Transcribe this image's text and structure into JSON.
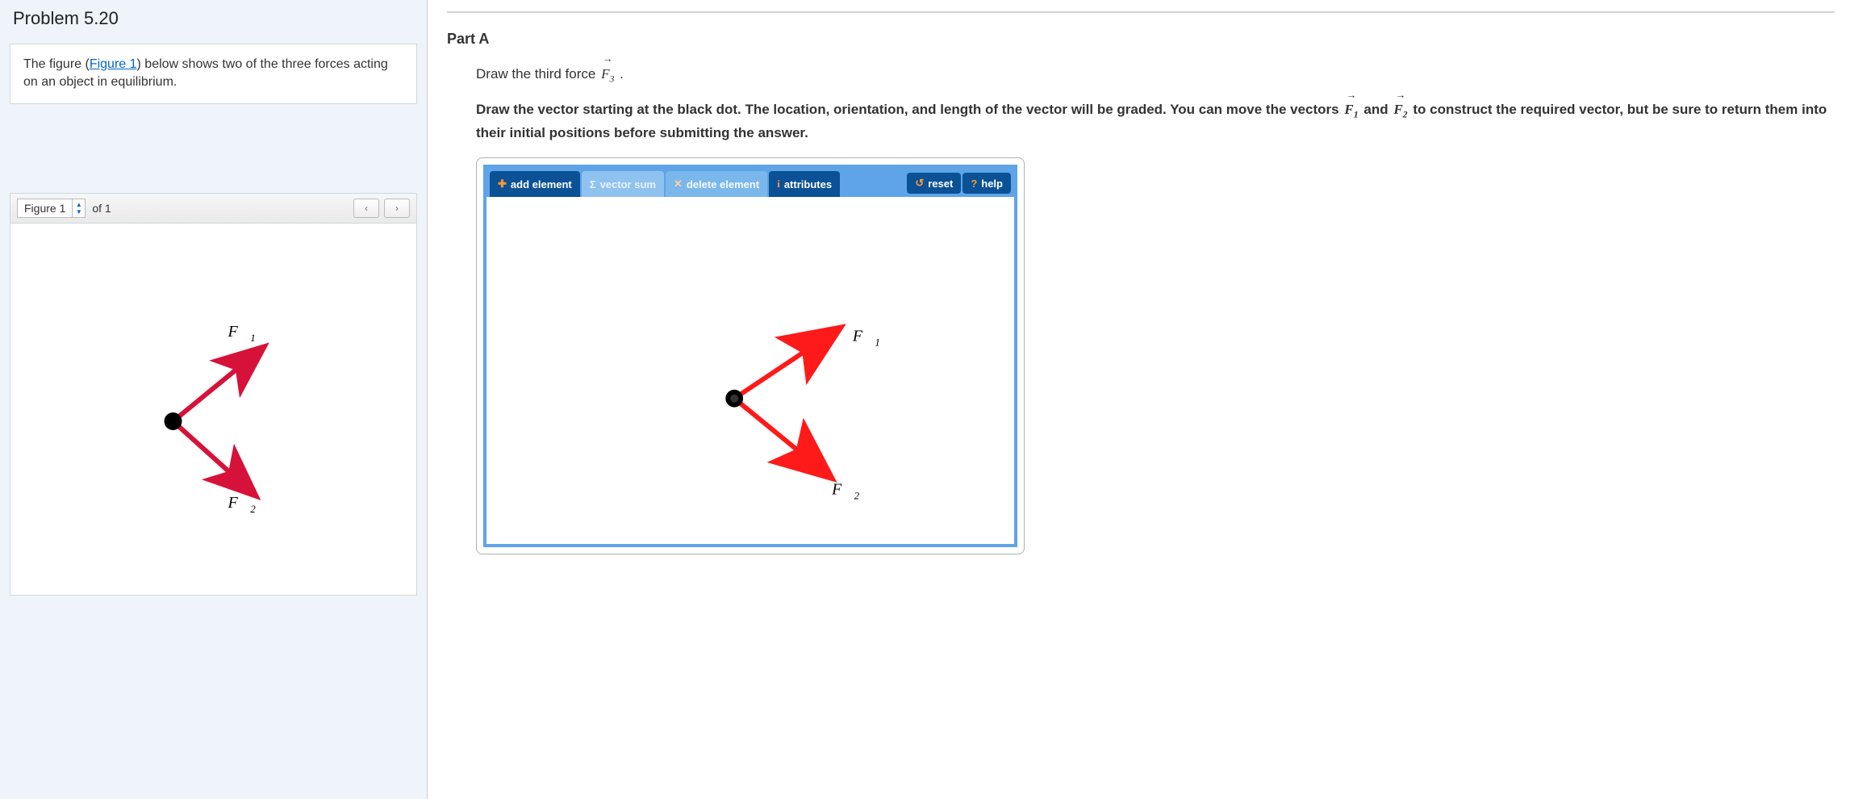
{
  "problem": {
    "title": "Problem 5.20",
    "intro_pre": "The figure (",
    "intro_link": "Figure 1",
    "intro_post": ") below shows two of the three forces acting on an object in equilibrium."
  },
  "figure": {
    "selector_label": "Figure 1",
    "of_text": "of 1",
    "labels": {
      "f1": "F",
      "f1_sub": "1",
      "f2": "F",
      "f2_sub": "2"
    }
  },
  "part": {
    "label": "Part A",
    "line1_pre": "Draw the third force ",
    "line1_vec": "F",
    "line1_sub": "3",
    "line1_post": " .",
    "instr_a": "Draw the vector starting at the black dot. The location, orientation, and length of the vector will be graded. You can move the vectors ",
    "instr_v1": "F",
    "instr_v1_sub": "1",
    "instr_mid": " and ",
    "instr_v2": "F",
    "instr_v2_sub": "2",
    "instr_b": " to construct the required vector, but be sure to return them into their initial positions before submitting the answer."
  },
  "toolbar": {
    "add": "add element",
    "sum": "vector sum",
    "del": "delete element",
    "attr": "attributes",
    "reset": "reset",
    "help": "help"
  },
  "canvas_labels": {
    "f1": "F",
    "f1_sub": "1",
    "f2": "F",
    "f2_sub": "2"
  }
}
